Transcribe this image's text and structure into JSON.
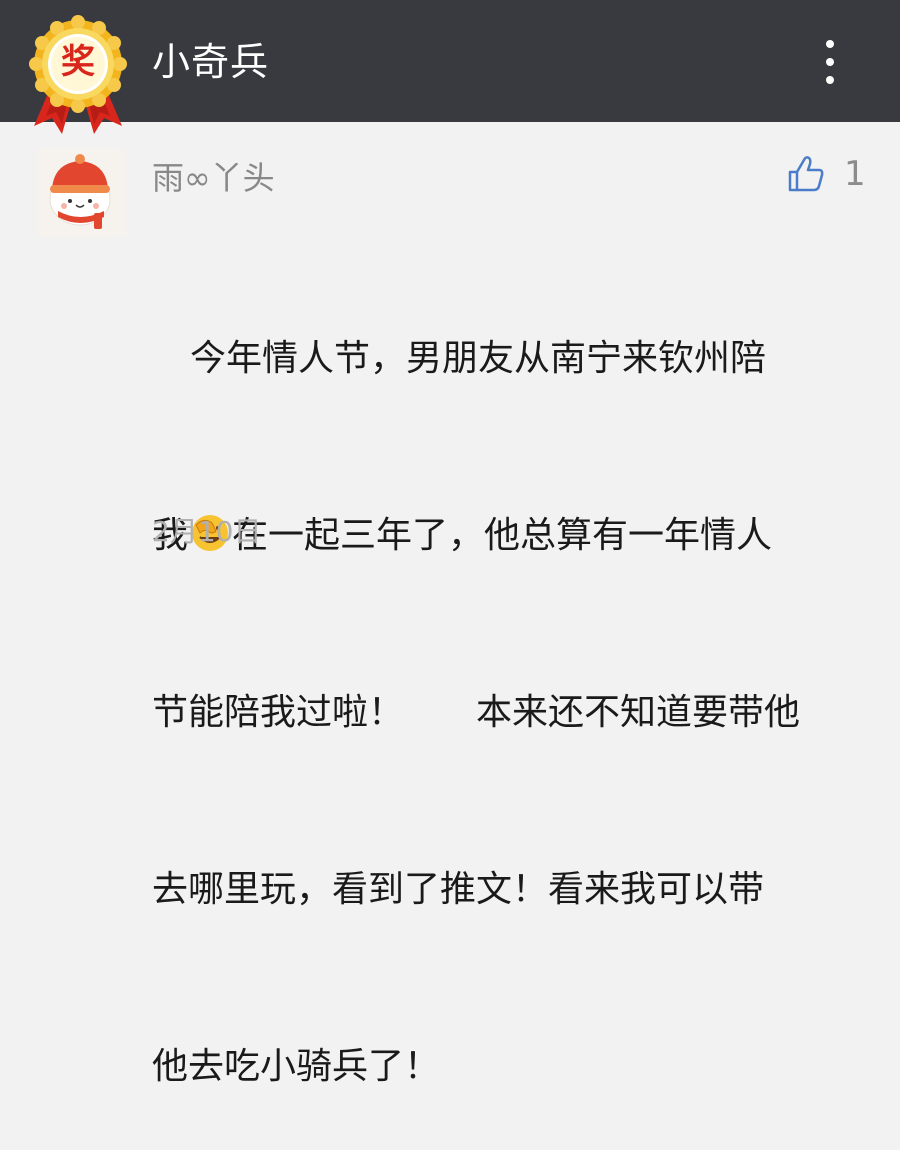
{
  "header": {
    "badge_text": "奖",
    "title": "小奇兵",
    "menu_icon": "more-vertical-icon"
  },
  "comment": {
    "nickname": "雨∞丫头",
    "like_icon": "thumbs-up-icon",
    "like_count": "1",
    "lines": [
      "今年情人节，男朋友从南宁来钦州陪",
      "在一起三年了，他总算有一年情人",
      "节能陪我过啦！　　本来还不知道要带他",
      "去哪里玩，看到了推文！看来我可以带",
      "他去吃小骑兵了！"
    ],
    "line2_prefix": "我",
    "emoji": "face-palm-emoji",
    "date": "2月10日"
  },
  "colors": {
    "header_bg": "#393a3f",
    "page_bg": "#f2f2f2",
    "text": "#1a1a1a",
    "muted": "#888888",
    "like_blue": "#4a7cc9"
  }
}
